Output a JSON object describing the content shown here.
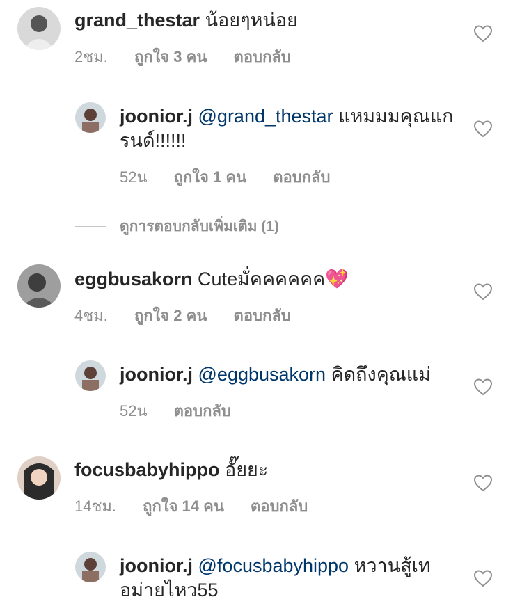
{
  "comments": [
    {
      "username": "grand_thestar",
      "text": "น้อยๆหน่อย",
      "time": "2ชม.",
      "likes": "ถูกใจ 3 คน",
      "reply_label": "ตอบกลับ"
    },
    {
      "username": "joonior.j",
      "mention": "@grand_thestar",
      "text": "แหมมมคุณแกรนด์!!!!!!",
      "time": "52น",
      "likes": "ถูกใจ 1 คน",
      "reply_label": "ตอบกลับ"
    },
    {
      "username": "eggbusakorn",
      "text": "Cuteมั่คคคคคค",
      "emoji": "💖",
      "time": "4ชม.",
      "likes": "ถูกใจ 2 คน",
      "reply_label": "ตอบกลับ"
    },
    {
      "username": "joonior.j",
      "mention": "@eggbusakorn",
      "text": "คิดถึงคุณแม่",
      "time": "52น",
      "reply_label": "ตอบกลับ"
    },
    {
      "username": "focusbabyhippo",
      "text": "อั๊ยยะ",
      "time": "14ชม.",
      "likes": "ถูกใจ 14 คน",
      "reply_label": "ตอบกลับ"
    },
    {
      "username": "joonior.j",
      "mention": "@focusbabyhippo",
      "text": "หวานสู้เทอม่ายไหว55"
    }
  ],
  "view_more_replies": "ดูการตอบกลับเพิ่มเติม (1)",
  "colors": {
    "mention": "#00376b",
    "meta": "#8e8e8e",
    "text": "#262626"
  }
}
